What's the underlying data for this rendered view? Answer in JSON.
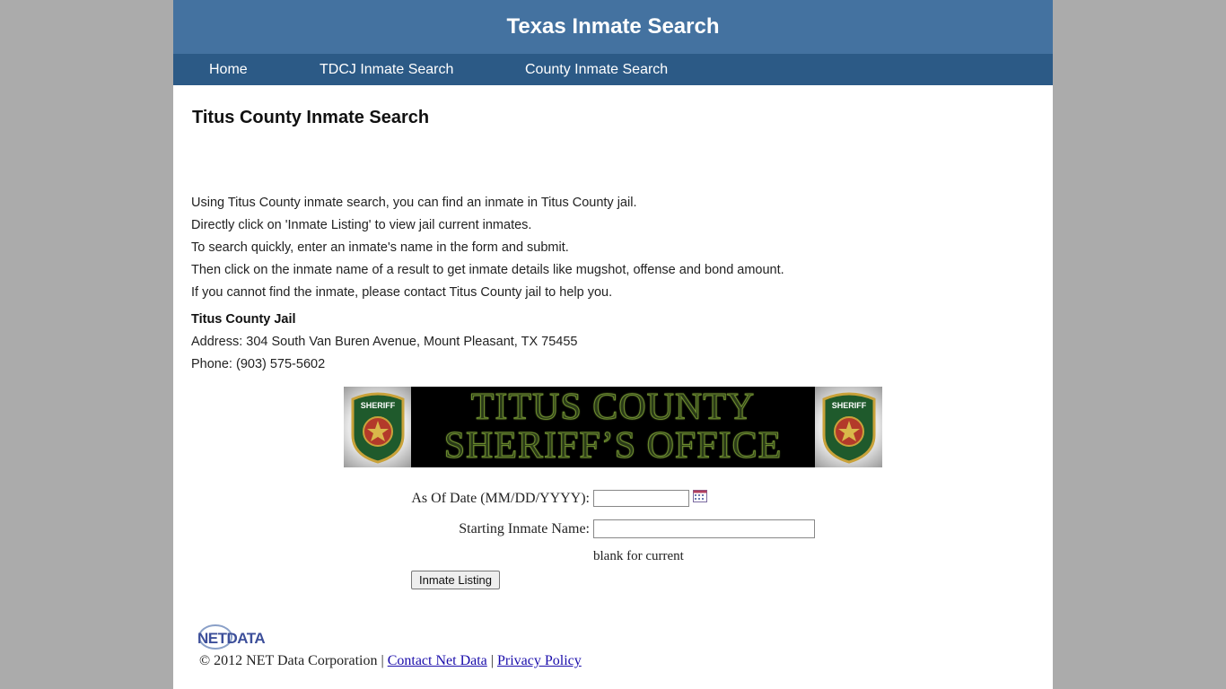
{
  "header": {
    "title": "Texas Inmate Search"
  },
  "nav": [
    {
      "label": "Home"
    },
    {
      "label": "TDCJ Inmate Search"
    },
    {
      "label": "County Inmate Search"
    }
  ],
  "main": {
    "heading": "Titus County Inmate Search",
    "intro": [
      "Using Titus County inmate search, you can find an inmate in Titus County jail.",
      "Directly click on 'Inmate Listing' to view jail current inmates.",
      "To search quickly, enter an inmate's name in the form and submit.",
      "Then click on the inmate name of a result to get inmate details like mugshot, offense and bond amount.",
      "If you cannot find the inmate, please contact Titus County jail to help you."
    ],
    "jail": {
      "name": "Titus County Jail",
      "address": "Address: 304 South Van Buren Avenue, Mount Pleasant, TX 75455",
      "phone": "Phone: (903) 575-5602"
    }
  },
  "banner": {
    "line1": "TITUS COUNTY",
    "line2": "SHERIFF’S OFFICE",
    "badge_text": "SHERIFF"
  },
  "form": {
    "date_label": "As Of Date (MM/DD/YYYY):",
    "date_value": "",
    "name_label": "Starting Inmate Name:",
    "name_value": "",
    "hint": "blank for current",
    "submit_label": "Inmate Listing"
  },
  "footer": {
    "logo_text": "NETDATA",
    "copyright": "© 2012 NET Data Corporation",
    "separator": "|",
    "contact_link": "Contact Net Data",
    "privacy_link": "Privacy Policy"
  },
  "colors": {
    "header_bg": "#4472a0",
    "nav_bg": "#2c5a86",
    "page_bg": "#ababab"
  }
}
